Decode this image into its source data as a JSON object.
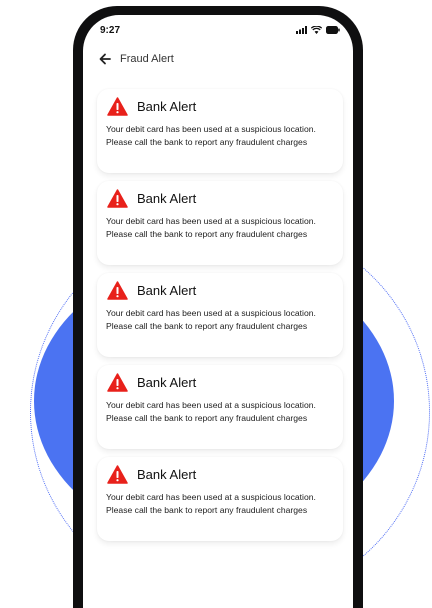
{
  "status_bar": {
    "time": "9:27"
  },
  "app_bar": {
    "title": "Fraud Alert"
  },
  "alerts": [
    {
      "title": "Bank Alert",
      "message": "Your debit card has been used at a suspicious location. Please call the bank to report any fraudulent charges"
    },
    {
      "title": "Bank Alert",
      "message": "Your debit card has been used at a suspicious location. Please call the bank to report any fraudulent charges"
    },
    {
      "title": "Bank Alert",
      "message": "Your debit card has been used at a suspicious location. Please call the bank to report any fraudulent charges"
    },
    {
      "title": "Bank Alert",
      "message": "Your debit card has been used at a suspicious location. Please call the bank to report any fraudulent charges"
    },
    {
      "title": "Bank Alert",
      "message": "Your debit card has been used at a suspicious location. Please call the bank to report any fraudulent charges"
    }
  ],
  "icons": {
    "alert": "warning-icon",
    "back": "arrow-left-icon",
    "signal": "signal-icon",
    "wifi": "wifi-icon",
    "battery": "battery-icon"
  },
  "colors": {
    "accent_blue": "#4b73f2",
    "warning_red": "#e8211b",
    "phone_frame": "#0f0f10"
  }
}
